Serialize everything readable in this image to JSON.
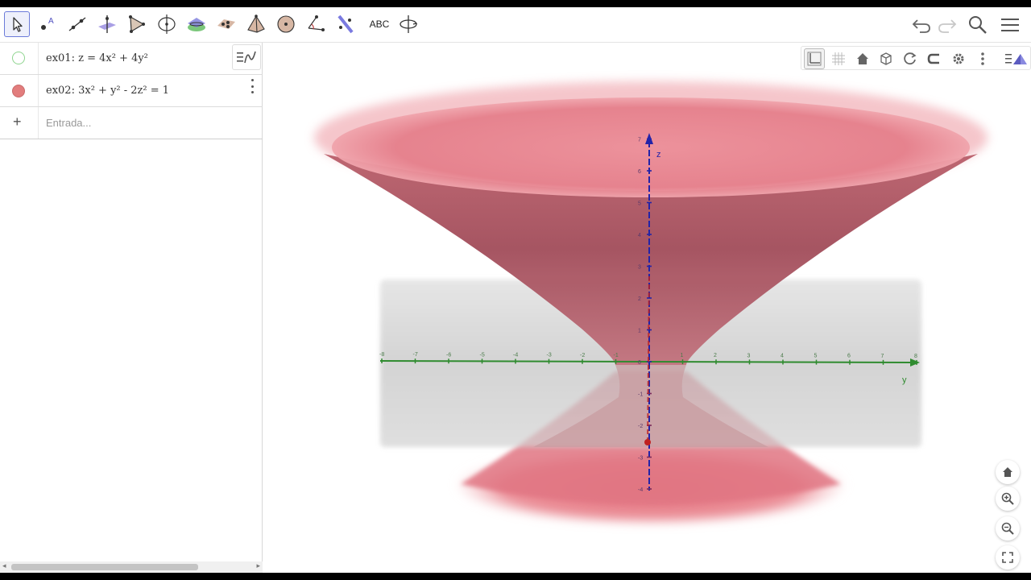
{
  "toolbar": {
    "tools": [
      {
        "name": "move-tool",
        "active": true
      },
      {
        "name": "point-tool"
      },
      {
        "name": "line-tool"
      },
      {
        "name": "perpendicular-line-tool"
      },
      {
        "name": "polygon-tool"
      },
      {
        "name": "circle-around-line-tool"
      },
      {
        "name": "intersect-surfaces-tool"
      },
      {
        "name": "plane-through-points-tool"
      },
      {
        "name": "pyramid-tool"
      },
      {
        "name": "sphere-tool"
      },
      {
        "name": "angle-tool"
      },
      {
        "name": "reflect-tool"
      },
      {
        "name": "text-tool",
        "label": "ABC"
      },
      {
        "name": "rotate-view-tool"
      }
    ],
    "right_icons": [
      "undo-icon",
      "redo-icon",
      "search-icon",
      "menu-icon"
    ]
  },
  "algebra": {
    "items": [
      {
        "label": "ex01",
        "expr": "z = 4x² + 4y²",
        "color": "#5cbf5c",
        "visible": false
      },
      {
        "label": "ex02",
        "expr": "3x² + y² - 2z² = 1",
        "color": "#e27d7d",
        "visible": true
      }
    ],
    "input_placeholder": "Entrada..."
  },
  "graphics": {
    "toolbar_icons": [
      "axes-icon",
      "grid-icon",
      "home-icon",
      "view-cube-icon",
      "rotate-icon",
      "projection-icon",
      "settings-icon",
      "more-icon"
    ],
    "view_toggle_icon": "perspectives-icon",
    "axes": {
      "z_label": "z",
      "y_label": "y",
      "z_ticks": [
        "7",
        "6",
        "5",
        "4",
        "3",
        "2",
        "1",
        "0",
        "-1",
        "-2",
        "-3",
        "-4"
      ],
      "y_ticks": [
        "-8",
        "-7",
        "-6",
        "-5",
        "-4",
        "-3",
        "-2",
        "-1",
        "1",
        "2",
        "3",
        "4",
        "5",
        "6",
        "7",
        "8"
      ]
    },
    "colors": {
      "surface": "#e27d7d",
      "plane": "#bdbdbd",
      "y_axis": "#2f8b2f",
      "z_axis": "#2323a8",
      "x_axis": "#c02020"
    },
    "float_buttons": [
      "home-view-icon",
      "zoom-in-icon",
      "zoom-out-icon",
      "fullscreen-icon"
    ]
  }
}
